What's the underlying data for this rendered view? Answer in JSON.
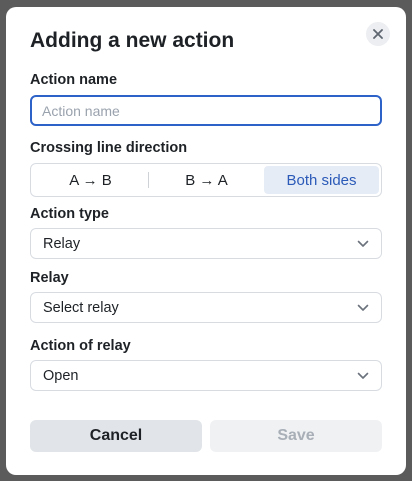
{
  "dialog": {
    "title": "Adding a new action",
    "close_icon": "close-icon"
  },
  "action_name": {
    "label": "Action name",
    "placeholder": "Action name",
    "value": ""
  },
  "direction": {
    "label": "Crossing line direction",
    "options": [
      "A → B",
      "B → A",
      "Both sides"
    ],
    "selected": "Both sides"
  },
  "action_type": {
    "label": "Action type",
    "value": "Relay"
  },
  "relay": {
    "label": "Relay",
    "value": "Select relay"
  },
  "action_of_relay": {
    "label": "Action of relay",
    "value": "Open"
  },
  "buttons": {
    "cancel": "Cancel",
    "save": "Save"
  },
  "colors": {
    "accent": "#2d62c8",
    "selected_segment_bg": "#e6ecf6",
    "cancel_bg": "#e1e4e8",
    "save_disabled_bg": "#eff1f3"
  }
}
